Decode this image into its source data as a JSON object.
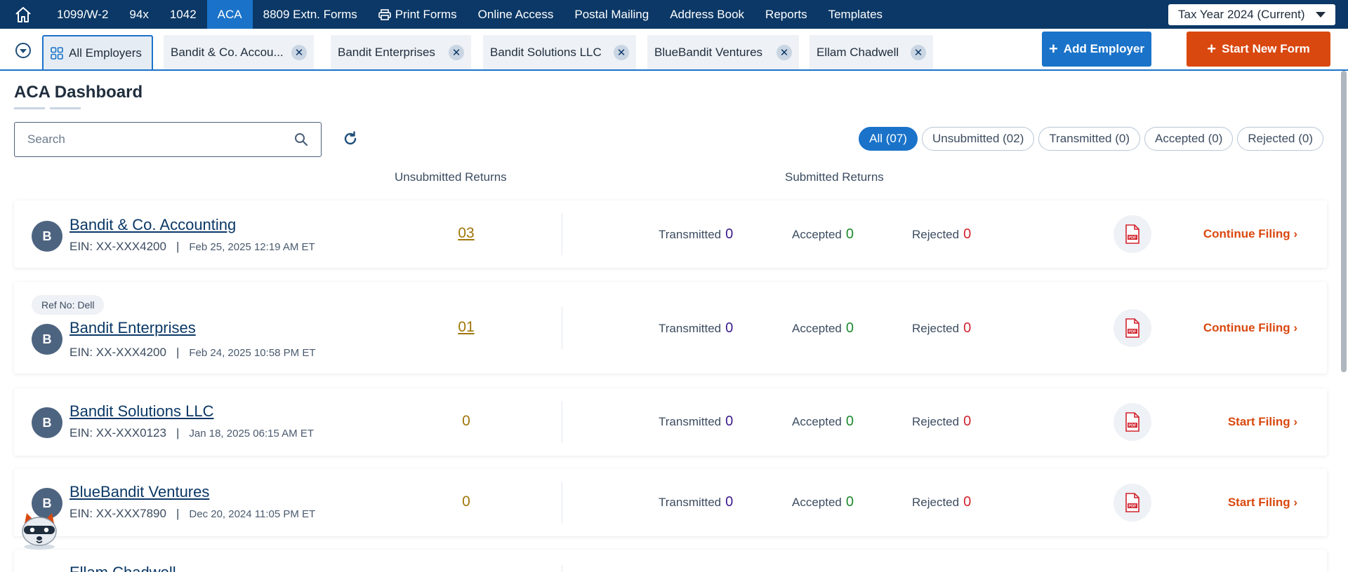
{
  "topnav": {
    "items": [
      "1099/W-2",
      "94x",
      "1042",
      "ACA",
      "8809 Extn. Forms",
      "Print Forms",
      "Online Access",
      "Postal Mailing",
      "Address Book",
      "Reports",
      "Templates"
    ],
    "active": "ACA",
    "tax_year": "Tax Year 2024 (Current)"
  },
  "tabs": {
    "all_label": "All Employers",
    "items": [
      "Bandit & Co. Accou...",
      "Bandit Enterprises",
      "Bandit Solutions LLC",
      "BlueBandit Ventures",
      "Ellam Chadwell"
    ],
    "close_glyph": "✕"
  },
  "buttons": {
    "add_employer": "Add Employer",
    "start_new_form": "Start New Form",
    "plus": "+"
  },
  "page": {
    "title": "ACA Dashboard",
    "search_placeholder": "Search"
  },
  "filters": [
    "All (07)",
    "Unsubmitted (02)",
    "Transmitted (0)",
    "Accepted (0)",
    "Rejected (0)"
  ],
  "columns": {
    "unsubmitted": "Unsubmitted Returns",
    "submitted": "Submitted Returns"
  },
  "stat_labels": {
    "transmitted": "Transmitted",
    "accepted": "Accepted",
    "rejected": "Rejected"
  },
  "employers": [
    {
      "initial": "B",
      "name": "Bandit & Co. Accounting",
      "ein": "EIN: XX-XXX4200",
      "date": "Feb 25, 2025 12:19 AM ET",
      "ref": "",
      "unsubmitted": "03",
      "transmitted": "0",
      "accepted": "0",
      "rejected": "0",
      "action": "Continue Filing"
    },
    {
      "initial": "B",
      "name": "Bandit Enterprises",
      "ein": "EIN: XX-XXX4200",
      "date": "Feb 24, 2025 10:58 PM ET",
      "ref": "Ref No: Dell",
      "unsubmitted": "01",
      "transmitted": "0",
      "accepted": "0",
      "rejected": "0",
      "action": "Continue Filing"
    },
    {
      "initial": "B",
      "name": "Bandit Solutions LLC",
      "ein": "EIN: XX-XXX0123",
      "date": "Jan 18, 2025 06:15 AM ET",
      "ref": "",
      "unsubmitted": "0",
      "transmitted": "0",
      "accepted": "0",
      "rejected": "0",
      "action": "Start Filing"
    },
    {
      "initial": "B",
      "name": "BlueBandit Ventures",
      "ein": "EIN: XX-XXX7890",
      "date": "Dec 20, 2024 11:05 PM ET",
      "ref": "",
      "unsubmitted": "0",
      "transmitted": "0",
      "accepted": "0",
      "rejected": "0",
      "action": "Start Filing"
    },
    {
      "initial": "",
      "name": "Ellam Chadwell",
      "ein": "",
      "date": "",
      "ref": "",
      "unsubmitted": "",
      "transmitted": "",
      "accepted": "",
      "rejected": "",
      "action": ""
    }
  ],
  "icons": {
    "home": "home-icon",
    "print": "printer-icon",
    "grid": "grid-icon",
    "search": "search-icon",
    "refresh": "refresh-icon",
    "pdf": "pdf-icon",
    "chevron": "chevron-right-icon"
  },
  "colors": {
    "nav_bg": "#0b3866",
    "accent_blue": "#1a73c9",
    "accent_orange": "#d9480f",
    "unsubmitted_gold": "#a0760a",
    "transmitted": "#3b1b8f",
    "accepted": "#1e8a2e",
    "rejected": "#d1242f"
  }
}
